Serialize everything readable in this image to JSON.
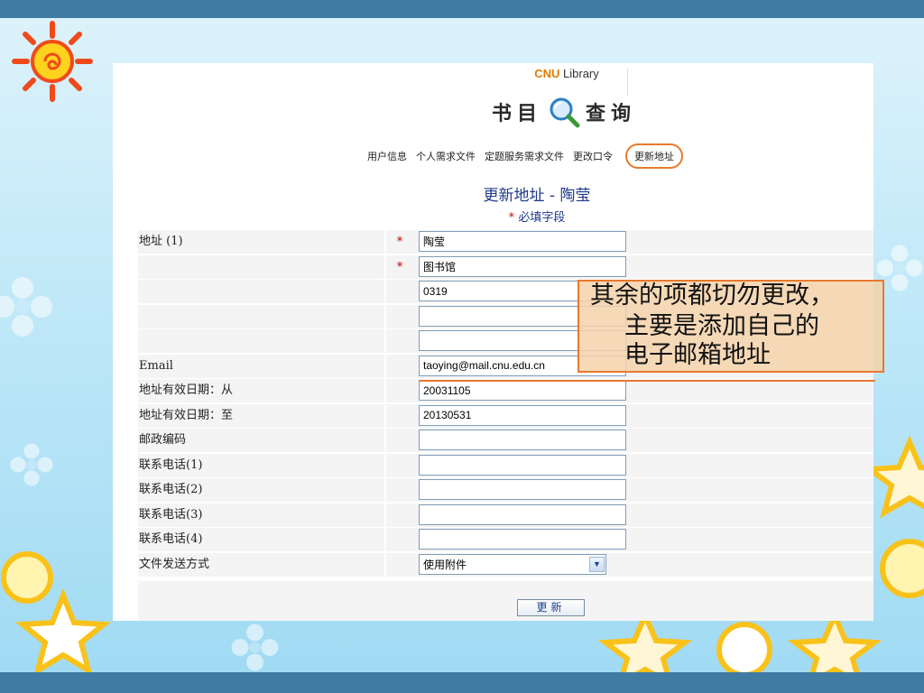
{
  "header": {
    "brand_prefix": "CNU",
    "brand_suffix": " Library",
    "catalog_left": "书目",
    "catalog_right": "查询",
    "magnifier_icon": "magnifier-icon"
  },
  "nav": {
    "items": [
      "用户信息",
      "个人需求文件",
      "定题服务需求文件",
      "更改口令",
      "更新地址"
    ],
    "active_index": 4,
    "active_color": "#e8792e"
  },
  "page": {
    "title": "更新地址 - 陶莹",
    "required_mark": "*",
    "required_note": "必填字段"
  },
  "form": {
    "rows": [
      {
        "label": "地址 (1)",
        "required": "*",
        "value": "陶莹"
      },
      {
        "label": "",
        "required": "*",
        "value": "图书馆"
      },
      {
        "label": "",
        "required": "",
        "value": "0319"
      },
      {
        "label": "",
        "required": "",
        "value": ""
      },
      {
        "label": "",
        "required": "",
        "value": ""
      },
      {
        "label": "Email",
        "required": "",
        "value": "taoying@mail.cnu.edu.cn"
      },
      {
        "label": "地址有效日期：从",
        "required": "",
        "value": "20031105"
      },
      {
        "label": "地址有效日期：至",
        "required": "",
        "value": "20130531"
      },
      {
        "label": "邮政编码",
        "required": "",
        "value": ""
      },
      {
        "label": "联系电话(1)",
        "required": "",
        "value": ""
      },
      {
        "label": "联系电话(2)",
        "required": "",
        "value": ""
      },
      {
        "label": "联系电话(3)",
        "required": "",
        "value": ""
      },
      {
        "label": "联系电话(4)",
        "required": "",
        "value": ""
      }
    ],
    "delivery": {
      "label": "文件发送方式",
      "selected": "使用附件"
    },
    "submit_label": "更新"
  },
  "callout": {
    "line1": "其余的项都切勿更改，",
    "line2": "主要是添加自己的",
    "line3": "电子邮箱地址",
    "border_color": "#e8792e",
    "fill_color": "#f5d2aa"
  },
  "theme": {
    "band_color": "#3f7ba3",
    "required_color": "#d20000",
    "title_color": "#1f3a8a"
  }
}
